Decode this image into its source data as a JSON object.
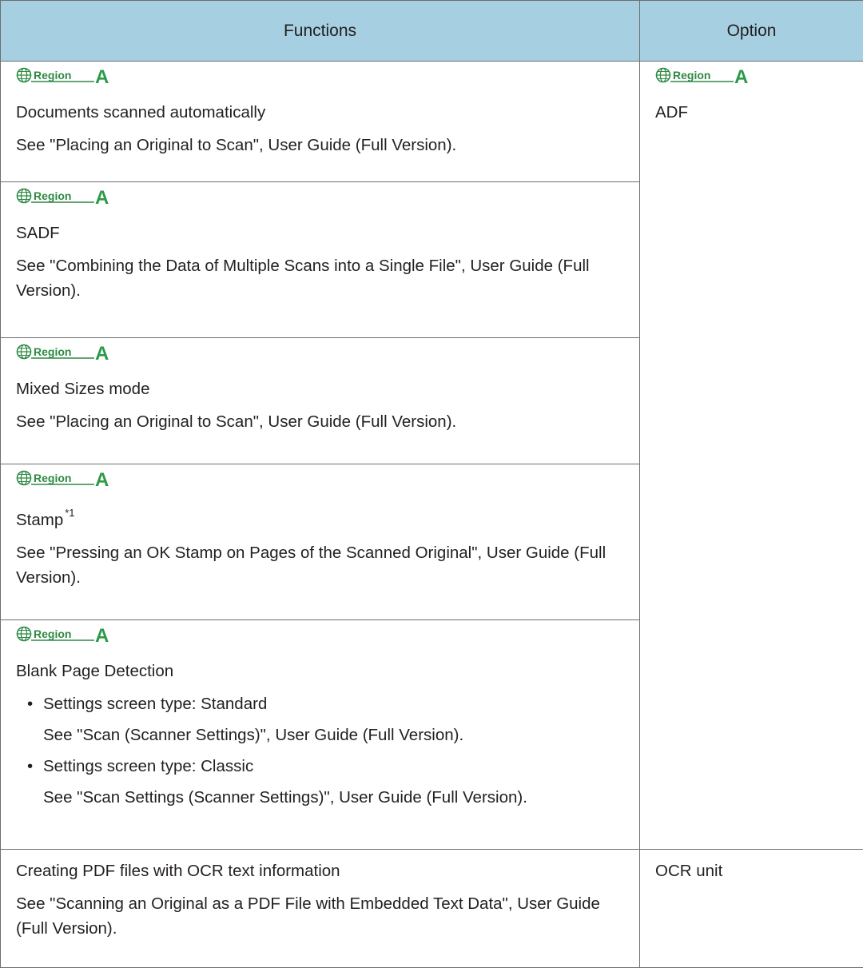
{
  "table": {
    "headers": {
      "functions": "Functions",
      "option": "Option"
    },
    "region_badge": {
      "label": "Region",
      "letter": "A",
      "icon": "globe-icon",
      "label_color": "#3e8e41",
      "letter_color": "#2e9a47"
    },
    "rows": [
      {
        "title": "Documents scanned automatically",
        "desc": "See \"Placing an Original to Scan\", User Guide (Full Version)."
      },
      {
        "title": "SADF",
        "desc": "See \"Combining the Data of Multiple Scans into a Single File\", User Guide (Full Version)."
      },
      {
        "title": "Mixed Sizes mode",
        "desc": "See \"Placing an Original to Scan\", User Guide (Full Version)."
      },
      {
        "title": "Stamp",
        "footnote": "*1",
        "desc": "See \"Pressing an OK Stamp on Pages of the Scanned Original\", User Guide (Full Version)."
      },
      {
        "title": "Blank Page Detection",
        "bullets": [
          {
            "text": "Settings screen type: Standard",
            "sub": "See \"Scan (Scanner Settings)\", User Guide (Full Version)."
          },
          {
            "text": "Settings screen type: Classic",
            "sub": "See \"Scan Settings (Scanner Settings)\", User Guide (Full Version)."
          }
        ]
      }
    ],
    "adf_option": "ADF",
    "ocr_row": {
      "title": "Creating PDF files with OCR text information",
      "desc": "See \"Scanning an Original as a PDF File with Embedded Text Data\", User Guide (Full Version).",
      "option": "OCR unit"
    }
  }
}
